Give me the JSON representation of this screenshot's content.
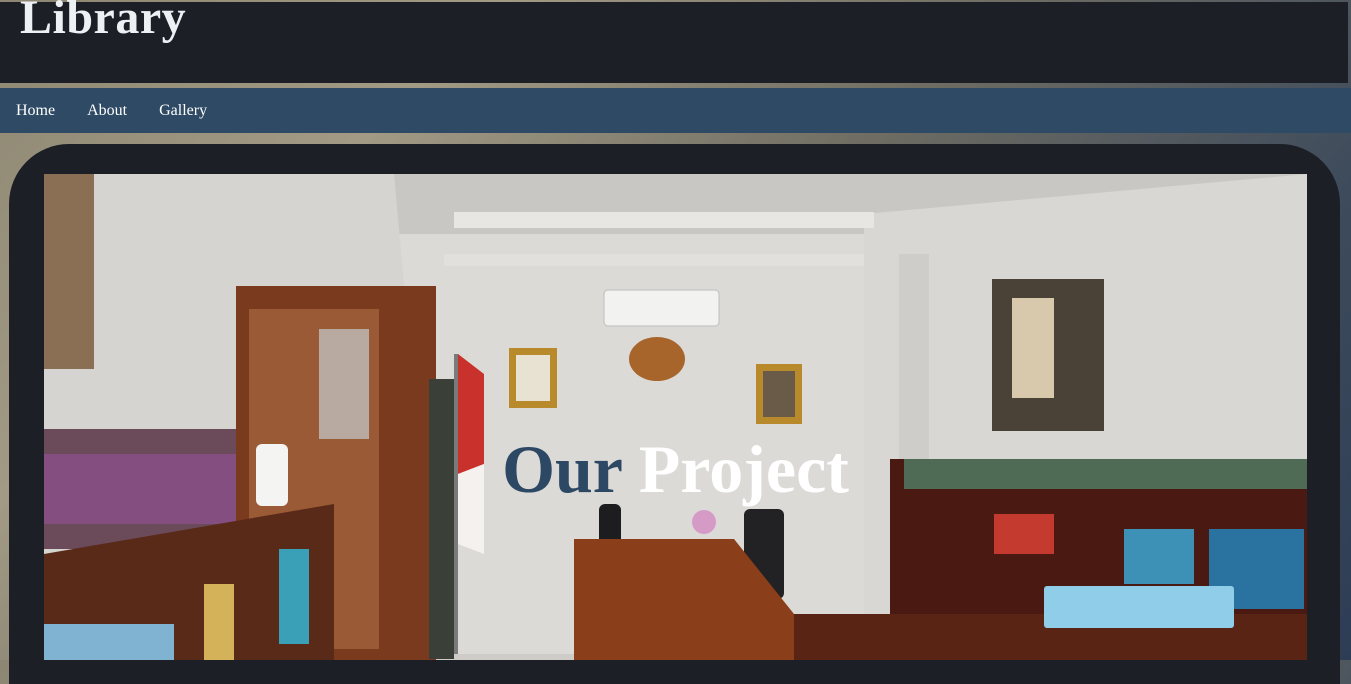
{
  "header": {
    "title": "Library"
  },
  "nav": {
    "items": [
      "Home",
      "About",
      "Gallery"
    ]
  },
  "hero": {
    "title_word_1": "Our",
    "title_word_2": "Project",
    "image_icon": "library-room-photo"
  },
  "colors": {
    "header_bg": "#1c2026",
    "nav_bg": "#2f4a64",
    "accent_word": "#2c4864"
  }
}
